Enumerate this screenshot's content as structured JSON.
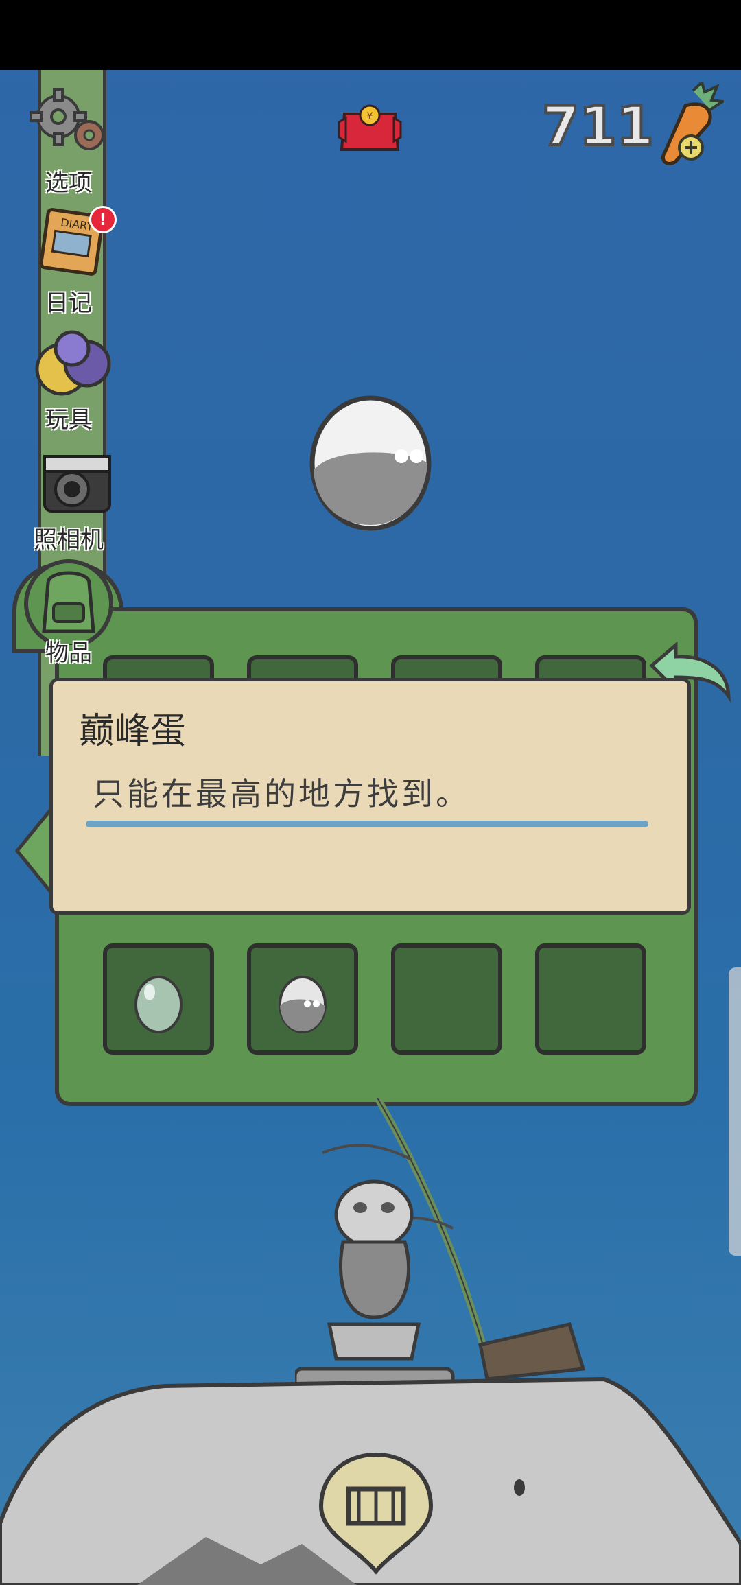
{
  "status_bar": {},
  "hud": {
    "carrot_count": "711",
    "red_envelope_icon": "red-envelope-icon",
    "carrot_add_icon": "carrot-plus-icon"
  },
  "sidebar": {
    "items": [
      {
        "label": "选项",
        "icon": "gear-icon"
      },
      {
        "label": "日记",
        "icon": "diary-icon",
        "badge": "!"
      },
      {
        "label": "玩具",
        "icon": "toy-balls-icon"
      },
      {
        "label": "照相机",
        "icon": "camera-icon"
      },
      {
        "label": "物品",
        "icon": "backpack-icon"
      }
    ]
  },
  "item_info": {
    "title": "巅峰蛋",
    "description": "只能在最高的地方找到。"
  },
  "inventory": {
    "slots": [
      {
        "contents": "egg-green-icon"
      },
      {
        "contents": "egg-grey-icon"
      },
      {
        "contents": ""
      },
      {
        "contents": ""
      }
    ]
  },
  "colors": {
    "panel_green": "#5d9551",
    "slot_green": "#41673d",
    "sky_blue": "#2c69a6",
    "info_bg": "#ead9b7",
    "accent_blue": "#6fa3c5"
  },
  "bottom": {
    "home_button_icon": "house-icon"
  }
}
